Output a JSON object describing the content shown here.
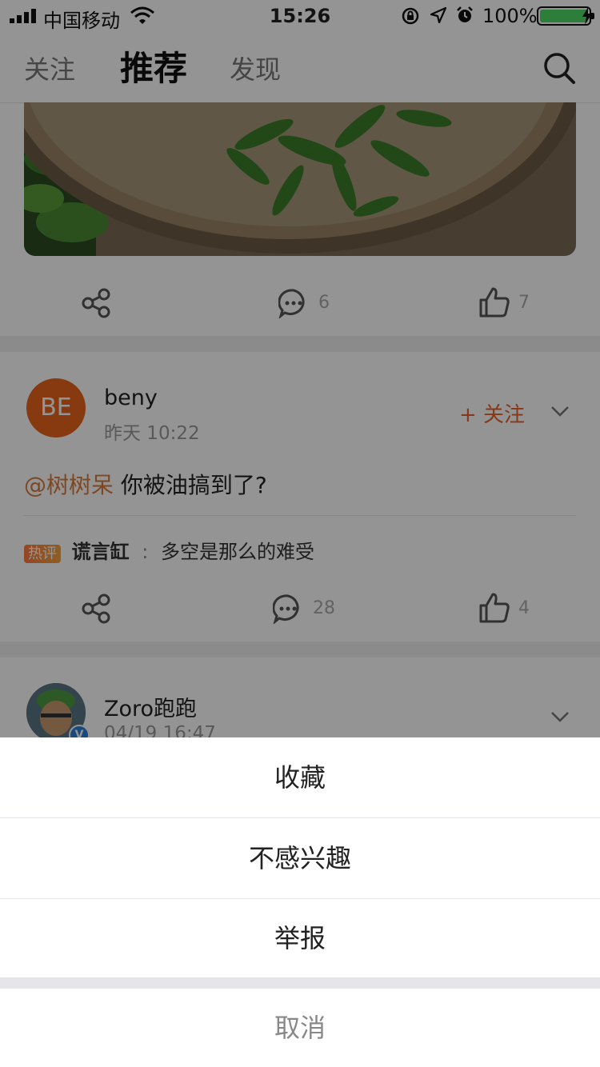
{
  "status_bar": {
    "carrier": "中国移动",
    "time": "15:26",
    "battery": "100%"
  },
  "nav": {
    "tabs": [
      "关注",
      "推荐",
      "发现"
    ],
    "active_index": 1
  },
  "post1": {
    "comments": "6",
    "likes": "7"
  },
  "post2": {
    "avatar_text": "BE",
    "avatar_color": "#e8641c",
    "username": "beny",
    "time": "昨天 10:22",
    "follow_label": "+ 关注",
    "mention": "@树树呆",
    "text": "你被油搞到了?",
    "hot_label": "热评",
    "hot_user": "谎言缸",
    "hot_sep": ":",
    "hot_text": "多空是那么的难受",
    "comments": "28",
    "likes": "4"
  },
  "post3": {
    "username": "Zoro跑跑",
    "time": "04/19 16:47"
  },
  "action_sheet": {
    "items": [
      "收藏",
      "不感兴趣",
      "举报"
    ],
    "cancel": "取消"
  },
  "colors": {
    "accent": "#e8612c",
    "mention": "#d97a3c",
    "battery": "#4cd964"
  }
}
